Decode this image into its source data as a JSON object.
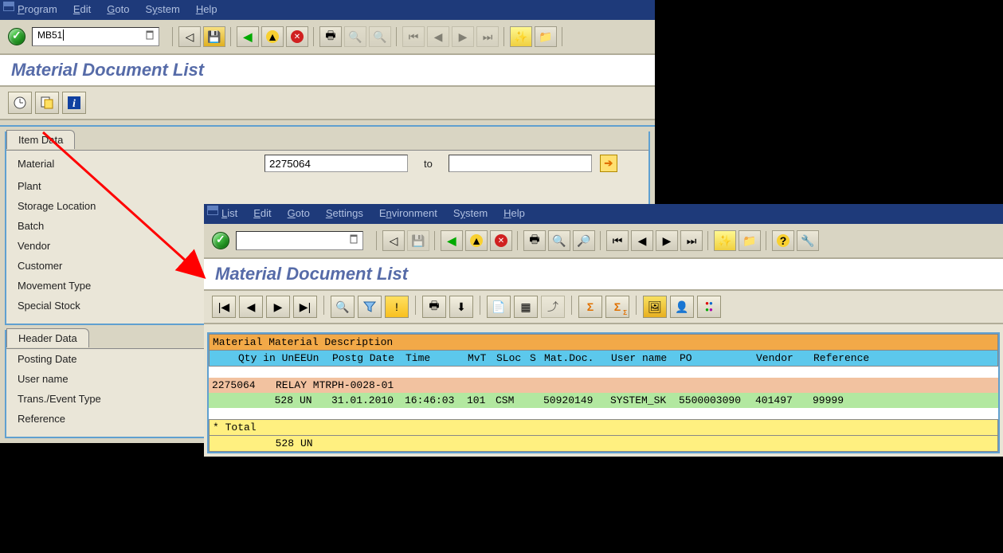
{
  "win1": {
    "menus": [
      "Program",
      "Edit",
      "Goto",
      "System",
      "Help"
    ],
    "tcode": "MB51",
    "page_title": "Material Document List",
    "block1": {
      "tab": "Item Data",
      "rows": [
        {
          "label": "Material",
          "low": "2275064",
          "high": ""
        },
        {
          "label": "Plant"
        },
        {
          "label": "Storage Location"
        },
        {
          "label": "Batch"
        },
        {
          "label": "Vendor"
        },
        {
          "label": "Customer"
        },
        {
          "label": "Movement Type"
        },
        {
          "label": "Special Stock"
        }
      ],
      "to": "to"
    },
    "block2": {
      "tab": "Header Data",
      "rows": [
        {
          "label": "Posting Date"
        },
        {
          "label": "User name"
        },
        {
          "label": "Trans./Event Type"
        },
        {
          "label": "Reference"
        }
      ]
    },
    "toolbar1": {
      "icons": [
        "back",
        "save",
        "green-back",
        "yellow-exit",
        "red-cancel",
        "print",
        "find",
        "find-next",
        "first",
        "prev",
        "next",
        "last",
        "create",
        "layout"
      ]
    }
  },
  "win2": {
    "menus": [
      "List",
      "Edit",
      "Goto",
      "Settings",
      "Environment",
      "System",
      "Help"
    ],
    "page_title": "Material Document List",
    "toolbar2_icons": [
      "first",
      "prev",
      "next",
      "last",
      "detail",
      "filter",
      "sum",
      "print",
      "export",
      "layout-choose",
      "layout-change",
      "download",
      "sigma",
      "sub-sigma",
      "chart",
      "user",
      "abc"
    ],
    "headers": {
      "h1": "Material Material Description",
      "h2_cells": {
        "qty": "   Qty in UnE",
        "eun": "EUn",
        "pdate": "Postg Date",
        "time": "Time",
        "mvt": "MvT",
        "sloc": "SLoc",
        "s": "S",
        "matdoc": "Mat.Doc.",
        "user": "User name",
        "po": "PO",
        "vendor": "Vendor",
        "ref": "Reference"
      }
    },
    "data": {
      "material": "2275064",
      "matdesc": "RELAY MTRPH-0028-01",
      "qty": "528",
      "eun": "UN",
      "pdate": "31.01.2010",
      "time": "16:46:03",
      "mvt": "101",
      "sloc": "CSM",
      "matdoc": "50920149",
      "user": "SYSTEM_SK",
      "po": "5500003090",
      "vendor": "401497",
      "ref": "99999"
    },
    "total": {
      "label": "* Total",
      "qty": "528",
      "eun": "UN"
    }
  }
}
